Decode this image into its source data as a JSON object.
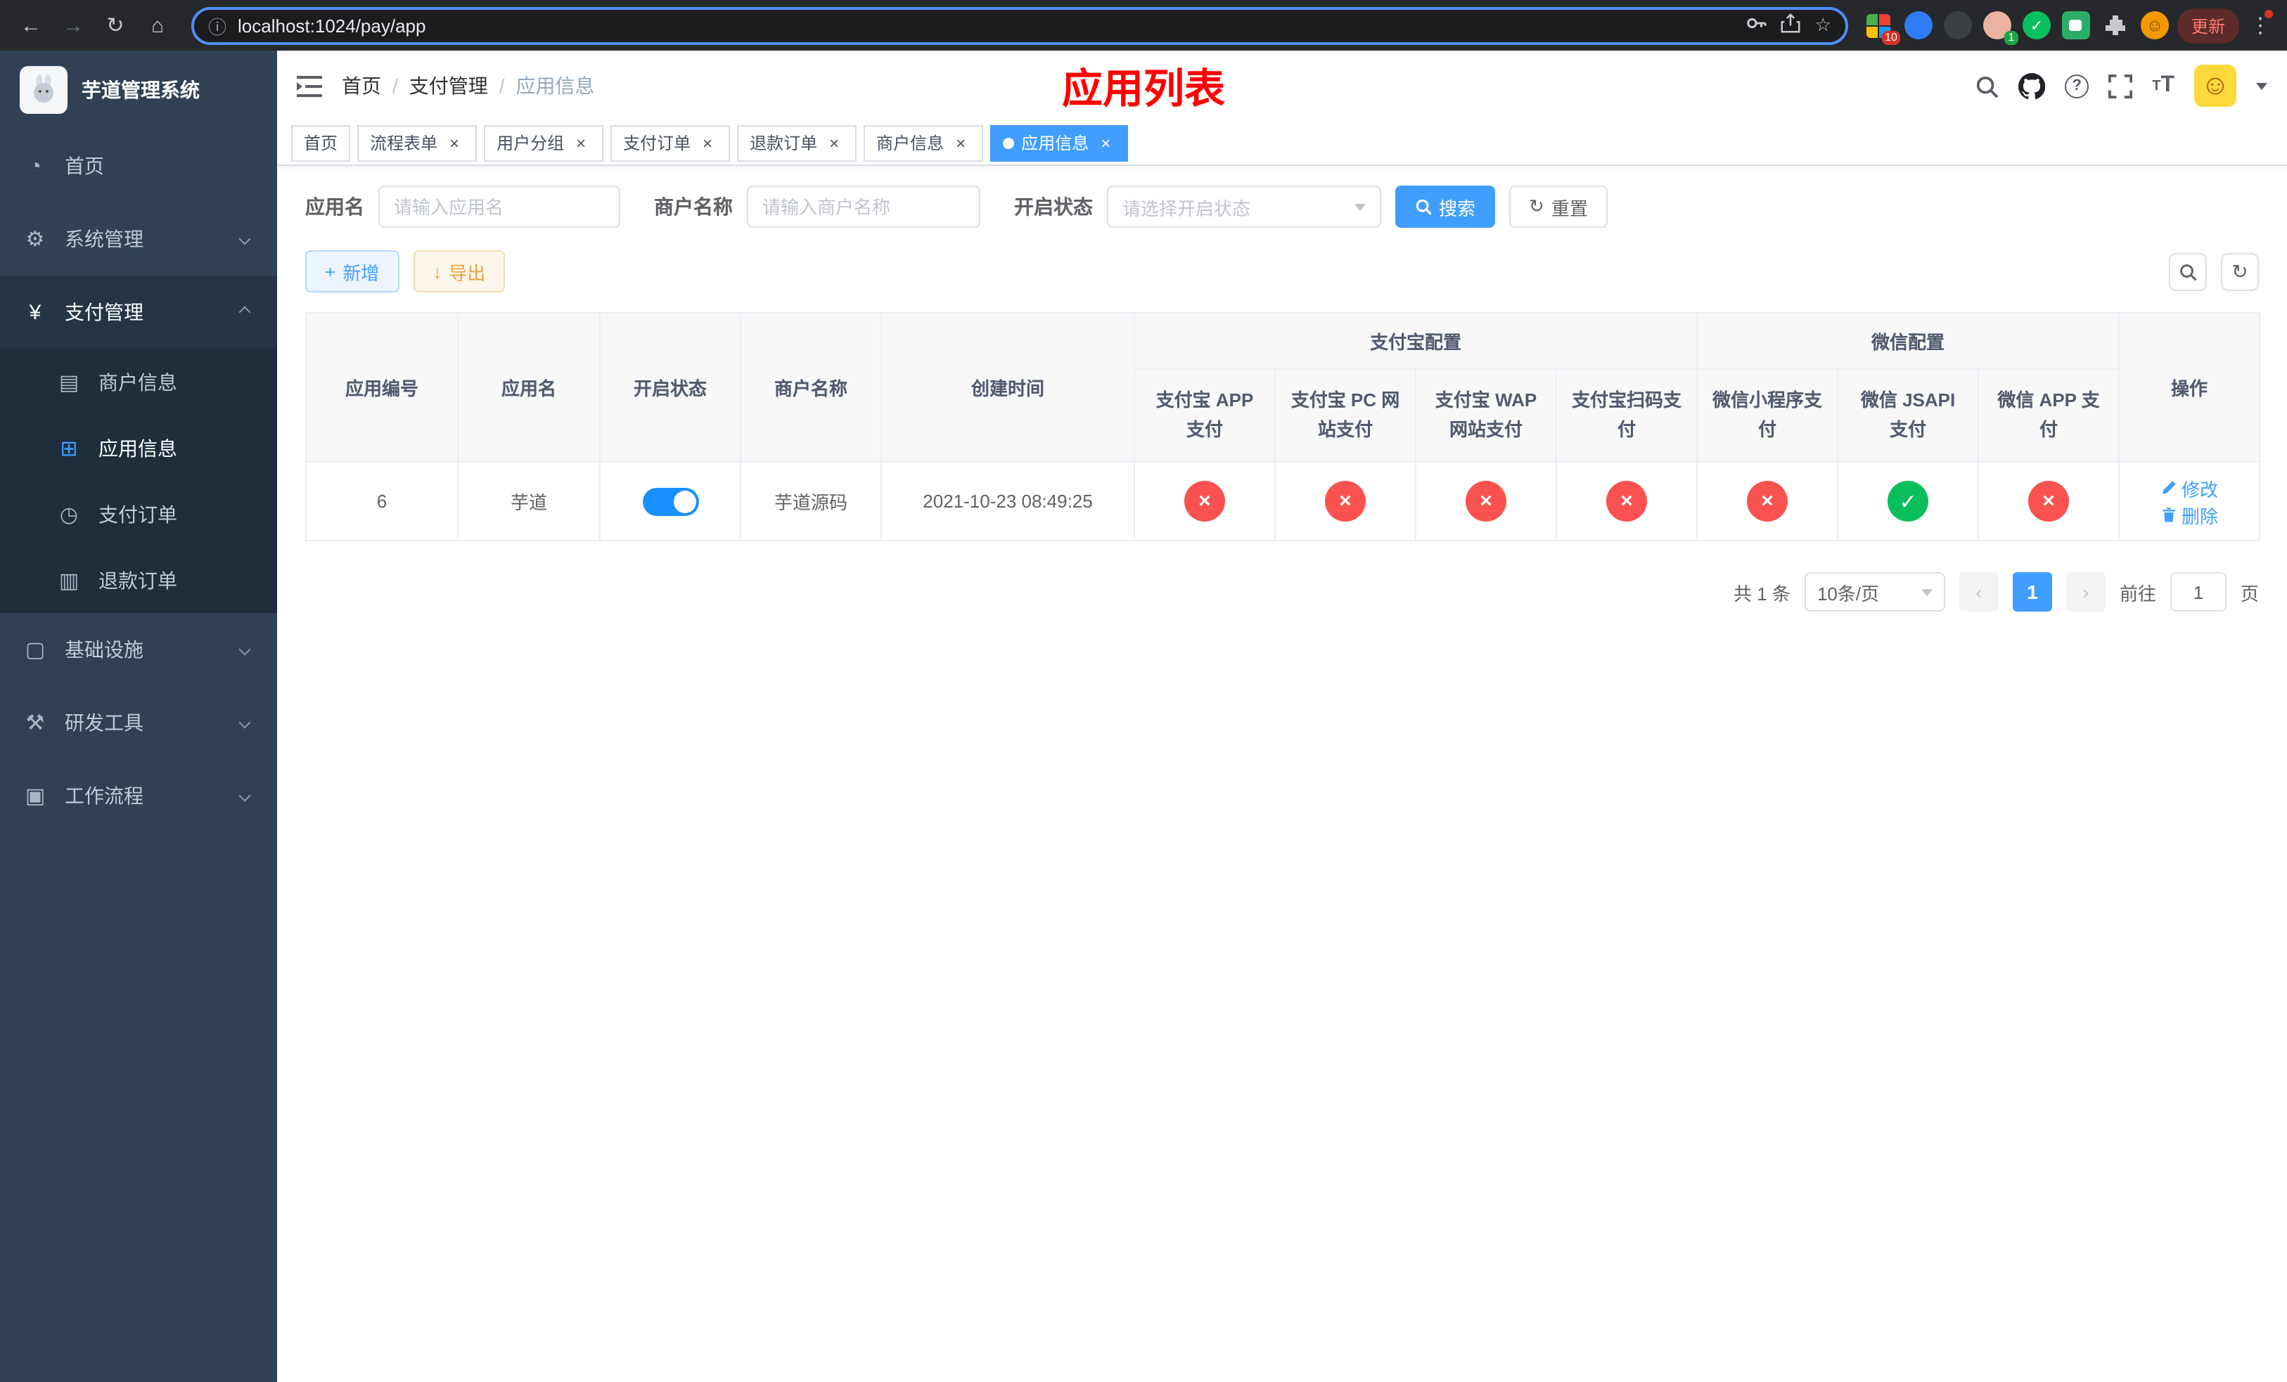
{
  "colors": {
    "accent": "#409eff",
    "danger": "#fa5151",
    "success": "#0abf5b",
    "warning": "#e6a23c",
    "sidebar_bg": "#304156",
    "title_red": "#ff0000"
  },
  "icons": {
    "back": "←",
    "forward": "→",
    "reload": "↻",
    "home": "⌂",
    "info": "ⓘ",
    "star": "☆",
    "kebab": "⋮",
    "smiley": "☺",
    "question": "?",
    "font_large": "T",
    "font_small": "T",
    "prev": "‹",
    "next": "›",
    "dashboard": "◔",
    "gear": "⚙",
    "yen": "¥",
    "card": "▤",
    "grid": "⊞",
    "order": "◷",
    "refund": "▥",
    "infra": "▢",
    "tool": "⚒",
    "flow": "▣",
    "plus": "+",
    "download": "↓",
    "refresh": "↻",
    "rabbit": "☺"
  },
  "browser": {
    "url": "localhost:1024/pay/app",
    "update_label": "更新",
    "extension_badge_grid": "10",
    "extension_badge_avatar": "1"
  },
  "sidebar": {
    "title": "芋道管理系统",
    "items": [
      {
        "label": "首页"
      },
      {
        "label": "系统管理"
      },
      {
        "label": "支付管理"
      },
      {
        "label": "基础设施"
      },
      {
        "label": "研发工具"
      },
      {
        "label": "工作流程"
      }
    ],
    "payment_children": [
      {
        "label": "商户信息"
      },
      {
        "label": "应用信息"
      },
      {
        "label": "支付订单"
      },
      {
        "label": "退款订单"
      }
    ]
  },
  "navbar": {
    "breadcrumb": [
      {
        "label": "首页"
      },
      {
        "label": "支付管理"
      },
      {
        "label": "应用信息"
      }
    ],
    "separator": "/",
    "page_title": "应用列表"
  },
  "tabs": [
    {
      "label": "首页"
    },
    {
      "label": "流程表单"
    },
    {
      "label": "用户分组"
    },
    {
      "label": "支付订单"
    },
    {
      "label": "退款订单"
    },
    {
      "label": "商户信息"
    },
    {
      "label": "应用信息"
    }
  ],
  "filters": {
    "app_name_label": "应用名",
    "app_name_placeholder": "请输入应用名",
    "merchant_label": "商户名称",
    "merchant_placeholder": "请输入商户名称",
    "status_label": "开启状态",
    "status_placeholder": "请选择开启状态",
    "search_button": "搜索",
    "reset_button": "重置"
  },
  "toolbar": {
    "add_button": "新增",
    "export_button": "导出"
  },
  "table": {
    "headers": {
      "app_id": "应用编号",
      "app_name": "应用名",
      "status": "开启状态",
      "merchant": "商户名称",
      "created": "创建时间",
      "actions": "操作",
      "alipay_group": "支付宝配置",
      "wechat_group": "微信配置",
      "channels": [
        "支付宝 APP 支付",
        "支付宝 PC 网站支付",
        "支付宝 WAP 网站支付",
        "支付宝扫码支付",
        "微信小程序支付",
        "微信 JSAPI 支付",
        "微信 APP 支付"
      ]
    },
    "row": {
      "app_id": "6",
      "app_name": "芋道",
      "status": "on",
      "merchant": "芋道源码",
      "created": "2021-10-23 08:49:25",
      "channel_states": [
        "disabled",
        "disabled",
        "disabled",
        "disabled",
        "disabled",
        "enabled",
        "disabled"
      ],
      "edit_label": "修改",
      "delete_label": "删除"
    }
  },
  "pagination": {
    "total": "共 1 条",
    "page_size": "10条/页",
    "page": "1",
    "goto_label": "前往",
    "goto_value": "1",
    "goto_unit": "页"
  }
}
